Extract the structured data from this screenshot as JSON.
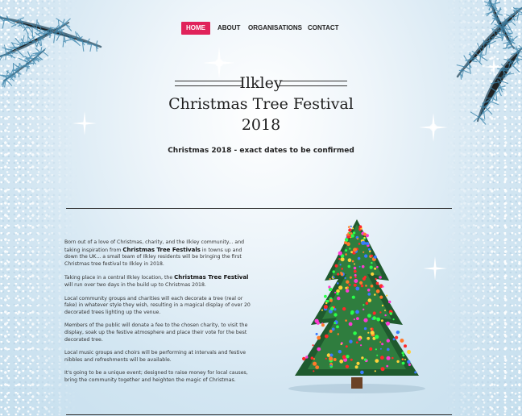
{
  "nav": {
    "items": [
      {
        "label": "HOME",
        "active": true
      },
      {
        "label": "ABOUT"
      },
      {
        "label": "ORGANISATIONS"
      },
      {
        "label": "CONTACT"
      }
    ],
    "active_color": "#e0225a"
  },
  "header": {
    "town": "Ilkley",
    "festival": "Christmas Tree Festival 2018"
  },
  "subtitle": "Christmas 2018 - exact dates to be confirmed",
  "intro": {
    "p1_before": "Born out of a love of Christmas, charity, and the Ilkley community... and taking inspiration from ",
    "p1_bold": "Christmas Tree Festivals",
    "p1_after": " in towns up and down the UK... a small team of Ilkley residents will be bringing the first Christmas tree festival to Ilkley in 2018.",
    "p2_before": "Taking place in a central Ilkley location, the ",
    "p2_bold": "Christmas Tree Festival",
    "p2_after": " will run over two days in the build up to Christmas 2018.",
    "p3": "Local community groups and charities will each decorate a tree (real or fake) in whatever style they wish, resulting in a magical display of over 20 decorated trees lighting up the venue.",
    "p4": "Members of the public will donate a fee to the chosen charity, to visit the display, soak up the festive atmosphere and place their vote for the best decorated tree.",
    "p5": "Local music groups and choirs will be performing at intervals and festive nibbles and refreshments will be available.",
    "p6": "It's going to be a unique event; designed to raise money for local causes, bring the community together and heighten the magic of Christmas."
  },
  "icons": {
    "branch": "pine-branch-icon",
    "sparkle": "sparkle-icon",
    "tree": "christmas-tree-icon"
  },
  "colors": {
    "background": "#d3e6f2",
    "text": "#222222",
    "branch": "#2f6f93"
  }
}
